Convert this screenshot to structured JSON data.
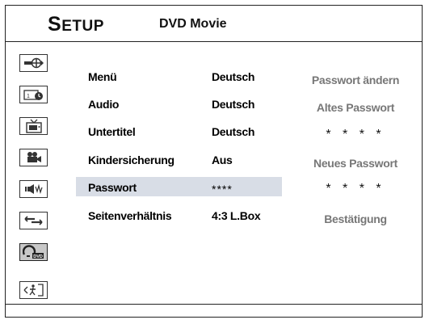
{
  "header": {
    "title_initial": "S",
    "title_rest": "ETUP",
    "subtitle": "DVD Movie"
  },
  "sidebar": {
    "icons": [
      {
        "name": "general-setup-icon"
      },
      {
        "name": "clock-setup-icon"
      },
      {
        "name": "tv-setup-icon"
      },
      {
        "name": "video-setup-icon"
      },
      {
        "name": "audio-setup-icon"
      },
      {
        "name": "connection-setup-icon"
      },
      {
        "name": "dvd-setup-icon",
        "active": true
      },
      {
        "name": "exit-icon"
      }
    ]
  },
  "settings": {
    "rows": [
      {
        "label": "Menü",
        "value": "Deutsch"
      },
      {
        "label": "Audio",
        "value": "Deutsch"
      },
      {
        "label": "Untertitel",
        "value": "Deutsch"
      },
      {
        "label": "Kindersicherung",
        "value": "Aus"
      },
      {
        "label": "Passwort",
        "value": "****"
      },
      {
        "label": "Seitenverhältnis",
        "value": "4:3 L.Box"
      }
    ],
    "selected_index": 4
  },
  "password_panel": {
    "change_label": "Passwort ändern",
    "old_label": "Altes Passwort",
    "old_value": "* * * *",
    "new_label": "Neues Passwort",
    "new_value": "* * * *",
    "confirm_label": "Bestätigung"
  },
  "colors": {
    "highlight": "#d8dde6",
    "active_icon": "#c8c8c8",
    "panel_text": "#777777"
  }
}
